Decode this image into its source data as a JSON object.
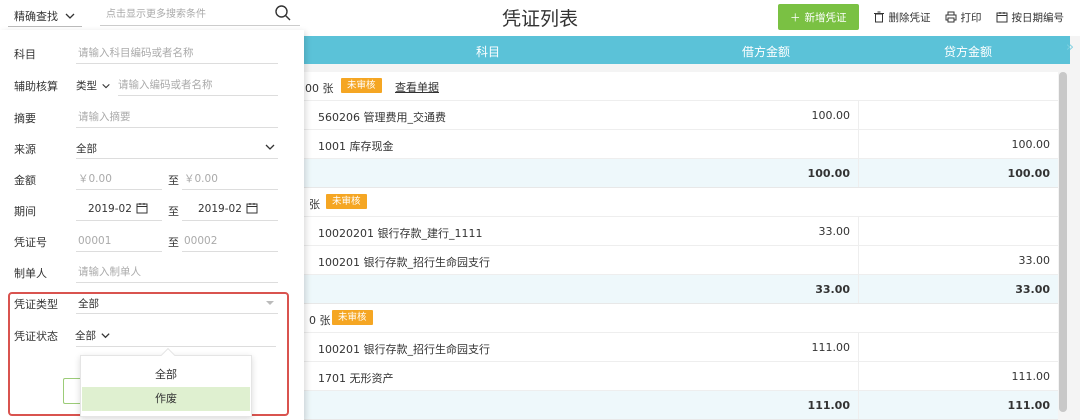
{
  "topbar": {
    "mode_label": "精确查找",
    "search_placeholder": "点击显示更多搜索条件",
    "title": "凭证列表",
    "add_label": "新增凭证",
    "delete_label": "删除凭证",
    "print_label": "打印",
    "renumber_label": "按日期编号"
  },
  "table": {
    "headers": [
      "科目",
      "借方金额",
      "贷方金额"
    ],
    "vouchers": [
      {
        "head_no": "00 张",
        "badge": "未审核",
        "view_label": "查看单据",
        "rows": [
          {
            "acct": "560206 管理费用_交通费",
            "debit": "100.00",
            "credit": ""
          },
          {
            "acct": "1001 库存现金",
            "debit": "",
            "credit": "100.00"
          }
        ],
        "total_debit": "100.00",
        "total_credit": "100.00"
      },
      {
        "head_no": "张",
        "badge": "未审核",
        "rows": [
          {
            "acct": "10020201 银行存款_建行_1111",
            "debit": "33.00",
            "credit": ""
          },
          {
            "acct": "100201 银行存款_招行生命园支行",
            "debit": "",
            "credit": "33.00"
          }
        ],
        "total_debit": "33.00",
        "total_credit": "33.00"
      },
      {
        "head_no": "0 张",
        "badge": "未审核",
        "rows": [
          {
            "acct": "100201 银行存款_招行生命园支行",
            "debit": "111.00",
            "credit": ""
          },
          {
            "acct": "1701 无形资产",
            "debit": "",
            "credit": "111.00"
          }
        ],
        "total_debit": "111.00",
        "total_credit": "111.00"
      }
    ]
  },
  "filter": {
    "subject_label": "科目",
    "subject_placeholder": "请输入科目编码或者名称",
    "aux_label": "辅助核算",
    "aux_type": "类型",
    "aux_placeholder": "请输入编码或者名称",
    "summary_label": "摘要",
    "summary_placeholder": "请输入摘要",
    "source_label": "来源",
    "source_value": "全部",
    "amount_label": "金额",
    "amount_from_placeholder": "￥0.00",
    "amount_to_placeholder": "￥0.00",
    "to_label": "至",
    "period_label": "期间",
    "period_from": "2019-02",
    "period_to": "2019-02",
    "voucher_no_label": "凭证号",
    "voucher_no_from_placeholder": "00001",
    "voucher_no_to_placeholder": "00002",
    "maker_label": "制单人",
    "maker_placeholder": "请输入制单人",
    "voucher_type_label": "凭证类型",
    "voucher_type_value": "全部",
    "status_label": "凭证状态",
    "status_value": "全部",
    "status_options": [
      "全部",
      "作废"
    ]
  }
}
